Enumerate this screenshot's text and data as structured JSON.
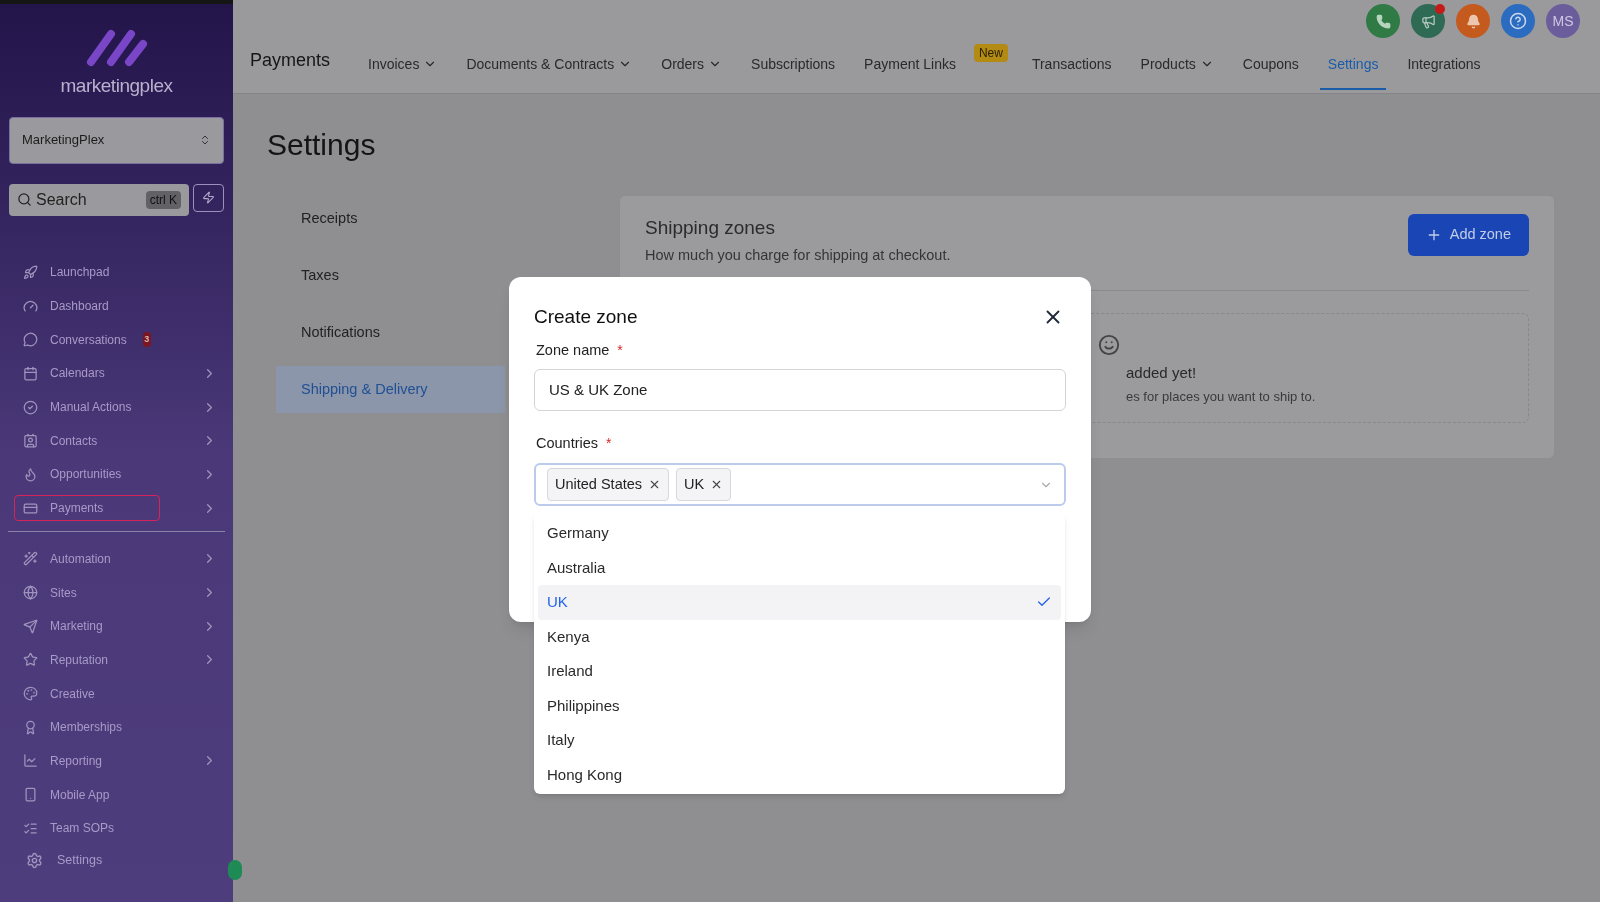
{
  "sidebar": {
    "logo_text": "marketingplex",
    "account": "MarketingPlex",
    "search": {
      "placeholder": "Search",
      "shortcut": "ctrl K"
    },
    "nav_groups": [
      [
        {
          "label": "Launchpad",
          "expandable": false,
          "selected": false
        },
        {
          "label": "Dashboard",
          "expandable": false,
          "selected": false
        },
        {
          "label": "Conversations",
          "expandable": false,
          "selected": false,
          "badge": "3"
        },
        {
          "label": "Calendars",
          "expandable": true,
          "selected": false
        },
        {
          "label": "Manual Actions",
          "expandable": true,
          "selected": false
        },
        {
          "label": "Contacts",
          "expandable": true,
          "selected": false
        },
        {
          "label": "Opportunities",
          "expandable": true,
          "selected": false
        },
        {
          "label": "Payments",
          "expandable": true,
          "selected": true
        }
      ],
      [
        {
          "label": "Automation",
          "expandable": true,
          "selected": false
        },
        {
          "label": "Sites",
          "expandable": true,
          "selected": false
        },
        {
          "label": "Marketing",
          "expandable": true,
          "selected": false
        },
        {
          "label": "Reputation",
          "expandable": true,
          "selected": false
        },
        {
          "label": "Creative",
          "expandable": false,
          "selected": false
        },
        {
          "label": "Memberships",
          "expandable": false,
          "selected": false
        },
        {
          "label": "Reporting",
          "expandable": true,
          "selected": false
        },
        {
          "label": "Mobile App",
          "expandable": false,
          "selected": false
        },
        {
          "label": "Team SOPs",
          "expandable": false,
          "selected": false
        }
      ]
    ],
    "footer_item": {
      "label": "Settings"
    }
  },
  "header": {
    "avatar": "MS",
    "section_title": "Payments",
    "tabs": [
      {
        "label": "Invoices",
        "dropdown": true,
        "selected": false
      },
      {
        "label": "Documents & Contracts",
        "dropdown": true,
        "selected": false
      },
      {
        "label": "Orders",
        "dropdown": true,
        "selected": false
      },
      {
        "label": "Subscriptions",
        "dropdown": false,
        "selected": false
      },
      {
        "label": "Payment Links",
        "dropdown": false,
        "selected": false,
        "badge": "New"
      },
      {
        "label": "Transactions",
        "dropdown": false,
        "selected": false
      },
      {
        "label": "Products",
        "dropdown": true,
        "selected": false
      },
      {
        "label": "Coupons",
        "dropdown": false,
        "selected": false
      },
      {
        "label": "Settings",
        "dropdown": false,
        "selected": true
      },
      {
        "label": "Integrations",
        "dropdown": false,
        "selected": false
      }
    ]
  },
  "page_title": "Settings",
  "settings_nav": [
    {
      "label": "Receipts",
      "selected": false
    },
    {
      "label": "Taxes",
      "selected": false
    },
    {
      "label": "Notifications",
      "selected": false
    },
    {
      "label": "Shipping & Delivery",
      "selected": true
    }
  ],
  "shipping_card": {
    "title": "Shipping zones",
    "subtitle": "How much you charge for shipping at checkout.",
    "add_button": "Add zone",
    "empty_title": "added yet!",
    "empty_text": "es for places you want to ship to."
  },
  "modal": {
    "title": "Create zone",
    "fields": [
      {
        "label": "Zone name",
        "required_mark": "*",
        "value": "US & UK Zone"
      },
      {
        "label": "Countries",
        "required_mark": "*",
        "chips": [
          "United States",
          "UK"
        ]
      }
    ],
    "options": [
      {
        "label": "Germany",
        "selected": false
      },
      {
        "label": "Australia",
        "selected": false
      },
      {
        "label": "UK",
        "selected": true
      },
      {
        "label": "Kenya",
        "selected": false
      },
      {
        "label": "Ireland",
        "selected": false
      },
      {
        "label": "Philippines",
        "selected": false
      },
      {
        "label": "Italy",
        "selected": false
      },
      {
        "label": "Hong Kong",
        "selected": false
      }
    ]
  }
}
